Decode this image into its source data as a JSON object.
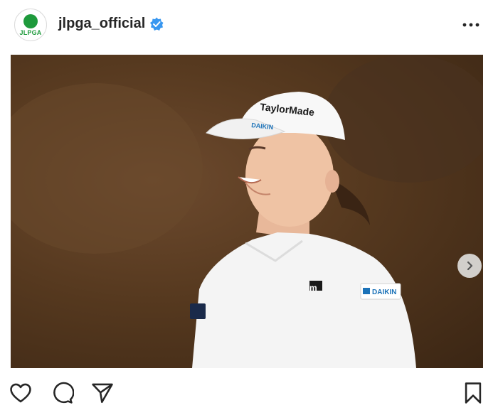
{
  "post": {
    "username": "jlpga_official",
    "avatar_logo_text": "JLPGA",
    "verified": true,
    "icons": {
      "more": "more-horizontal-icon",
      "next": "chevron-right-icon",
      "like": "heart-icon",
      "comment": "comment-bubble-icon",
      "share": "paper-plane-icon",
      "save": "bookmark-icon"
    },
    "colors": {
      "verified_badge": "#3897f0",
      "brand_green": "#1e9a3c",
      "text": "#262626"
    },
    "media": {
      "cap_brand": "TaylorMade",
      "cap_sponsor": "DAIKIN",
      "shirt_logo": "m",
      "sleeve_sponsor": "DAIKIN"
    }
  }
}
